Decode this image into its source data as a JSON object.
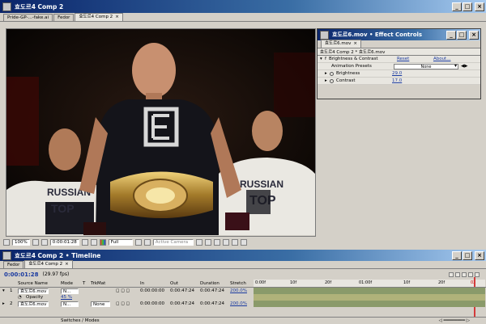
{
  "comp_window": {
    "title": "효도르4 Comp 2",
    "tabs": [
      "Pride-GP-...-fake.ai",
      "Fedor",
      "효도르4 Comp 2"
    ],
    "active_tab_index": 2
  },
  "viewer": {
    "shirt_brand": "RUSSIAN TOP TEAM"
  },
  "comp_toolbar": {
    "zoom": "100%",
    "timecode": "0:00:01:28",
    "resolution": "Full",
    "camera": "Active Camera"
  },
  "effect_controls": {
    "title": "효도르6.mov • Effect Controls",
    "tab_label": "효도르6.mov",
    "breadcrumb": "효도르4 Comp 2 * 효도르6.mov",
    "effect_name": "Brightness & Contrast",
    "reset_label": "Reset",
    "about_label": "About...",
    "presets_label": "Animation Presets",
    "presets_value": "None",
    "params": [
      {
        "name": "Brightness",
        "value": "29.0"
      },
      {
        "name": "Contrast",
        "value": "17.0"
      }
    ]
  },
  "timeline": {
    "title": "효도르4 Comp 2 • Timeline",
    "tabs": [
      "Fedor",
      "효도르4 Comp 2"
    ],
    "timecode": "0:00:01:28",
    "fps": "(29.97 fps)",
    "headers": {
      "source_name": "Source Name",
      "mode": "Mode",
      "t": "T",
      "trkmat": "TrkMat",
      "in": "In",
      "out": "Out",
      "duration": "Duration",
      "stretch": "Stretch"
    },
    "ruler_labels": [
      "0:00f",
      "10f",
      "20f",
      "01:00f",
      "10f",
      "20f",
      "02"
    ],
    "layers": [
      {
        "num": "1",
        "name": "효도르6.mov",
        "mode": "N...",
        "trkmat": "",
        "in": "0:00:00:00",
        "out": "0:00:47:24",
        "duration": "0:00:47:24",
        "stretch": "200.0%"
      },
      {
        "num": "2",
        "name": "효도르6.mov",
        "mode": "N...",
        "trkmat": "None",
        "in": "0:00:00:00",
        "out": "0:00:47:24",
        "duration": "0:00:47:24",
        "stretch": "200.0%"
      }
    ],
    "sub_property": {
      "name": "Opacity",
      "value": "45 %"
    },
    "switches_label": "Switches / Modes"
  },
  "colors": {
    "title_active": "#0a246a",
    "link_blue": "#1a3aa0",
    "track_green": "#8a9a6a"
  }
}
